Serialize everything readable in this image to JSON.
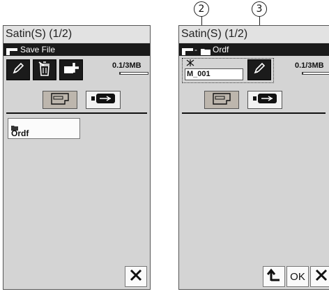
{
  "left_screen": {
    "title": "Satin(S) (1/2)",
    "header_label": "Save File",
    "memory_text": "0.1/3MB",
    "memory_fraction": 0.03,
    "folder_name": "Ordf"
  },
  "right_screen": {
    "title": "Satin(S) (1/2)",
    "breadcrumb_folder": "Ordf",
    "memory_text": "0.1/3MB",
    "memory_fraction": 0.03,
    "file_name": "M_001",
    "ok_label": "OK"
  },
  "callouts": [
    "2",
    "3"
  ],
  "icons": [
    "machine-icon",
    "pencil-icon",
    "trash-icon",
    "folder-plus-icon",
    "usb-icon",
    "folder-icon",
    "close-icon",
    "back-arrow-icon"
  ]
}
